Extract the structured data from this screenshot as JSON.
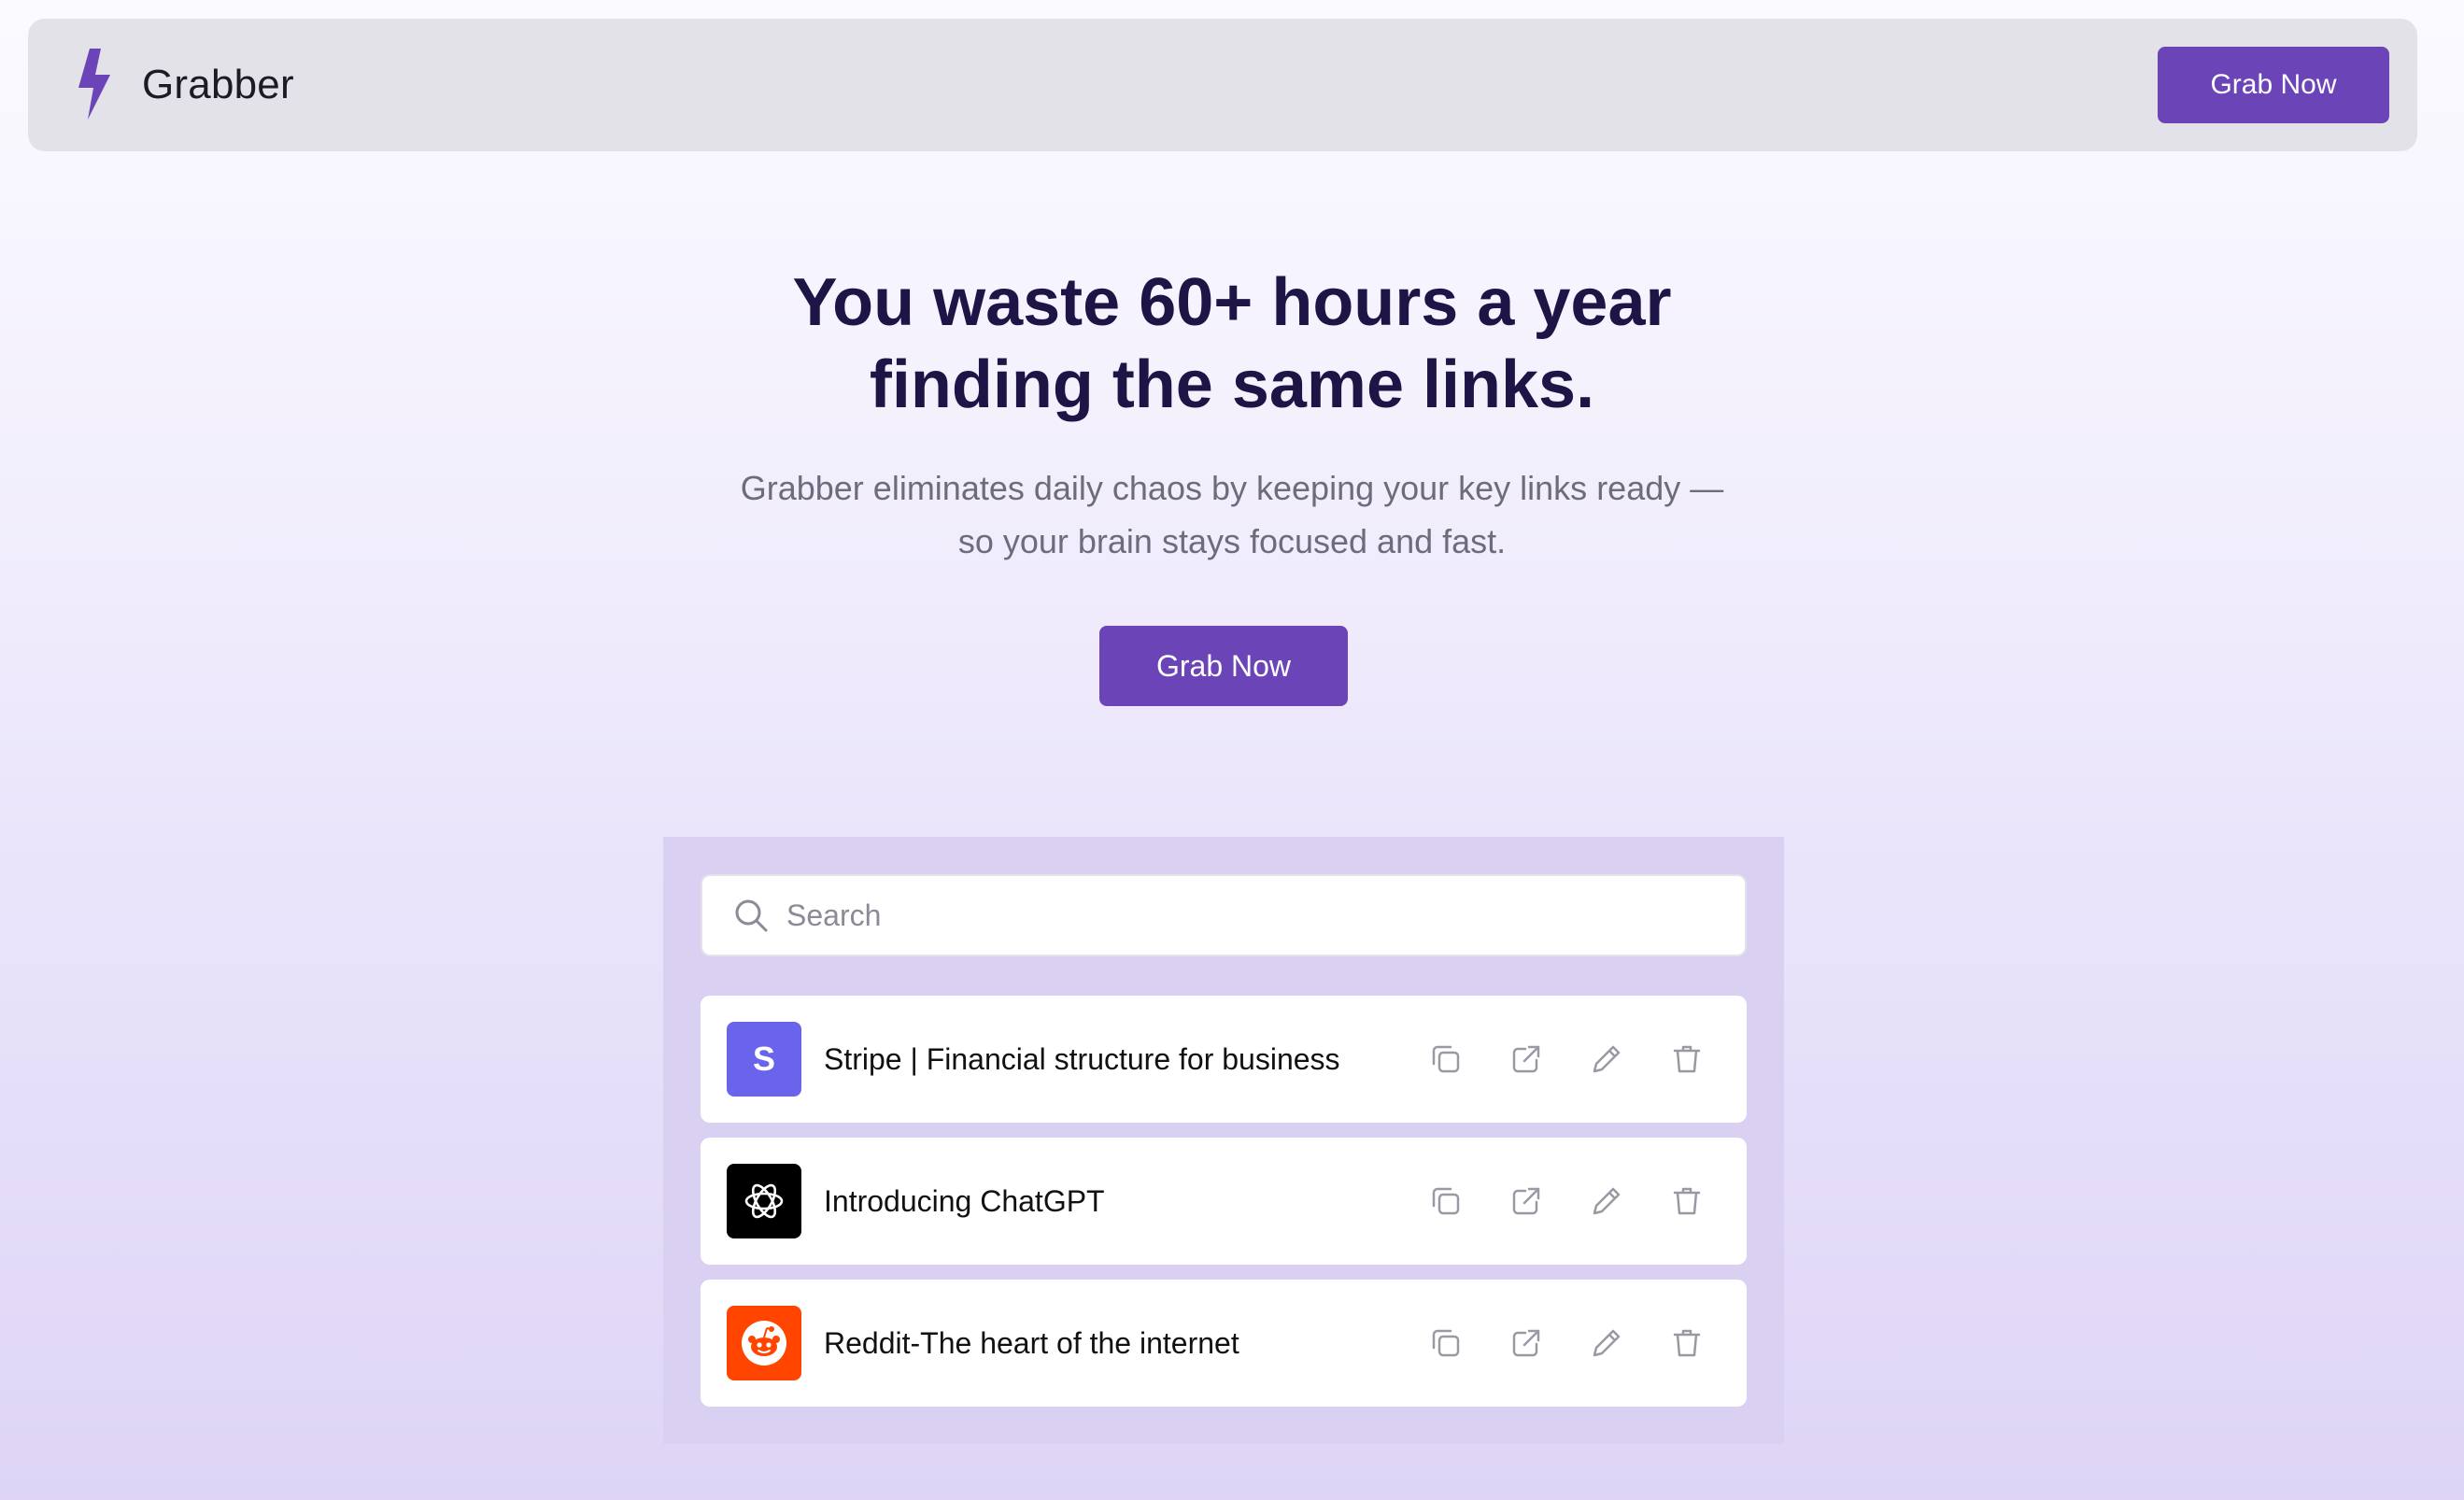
{
  "header": {
    "brand": "Grabber",
    "logo_icon": "lightning-bolt-icon",
    "cta_label": "Grab Now"
  },
  "hero": {
    "title_line1": "You waste 60+ hours a year",
    "title_line2": "finding the same links.",
    "subtitle_line1": "Grabber eliminates daily chaos by keeping your key links ready —",
    "subtitle_line2": "so your brain stays focused and fast.",
    "cta_label": "Grab Now"
  },
  "demo": {
    "search": {
      "placeholder": "Search",
      "value": "",
      "icon": "search-icon"
    },
    "links": [
      {
        "favicon_text": "S",
        "favicon_icon": "stripe-logo-icon",
        "title": "Stripe | Financial structure for business"
      },
      {
        "favicon_text": "",
        "favicon_icon": "chatgpt-logo-icon",
        "title": "Introducing ChatGPT"
      },
      {
        "favicon_text": "",
        "favicon_icon": "reddit-logo-icon",
        "title": "Reddit-The heart of the internet"
      }
    ],
    "actions": [
      "copy-icon",
      "external-link-icon",
      "edit-icon",
      "delete-icon"
    ]
  },
  "colors": {
    "accent": "#6b45b8",
    "header_bg": "#e3e2e8",
    "panel_bg": "#dad0f1",
    "title_text": "#1f1446",
    "subtitle_text": "#6e6c7c",
    "stripe": "#6a63ec",
    "chatgpt": "#000000",
    "reddit": "#ff4500",
    "action_icon": "#9a99a3"
  }
}
